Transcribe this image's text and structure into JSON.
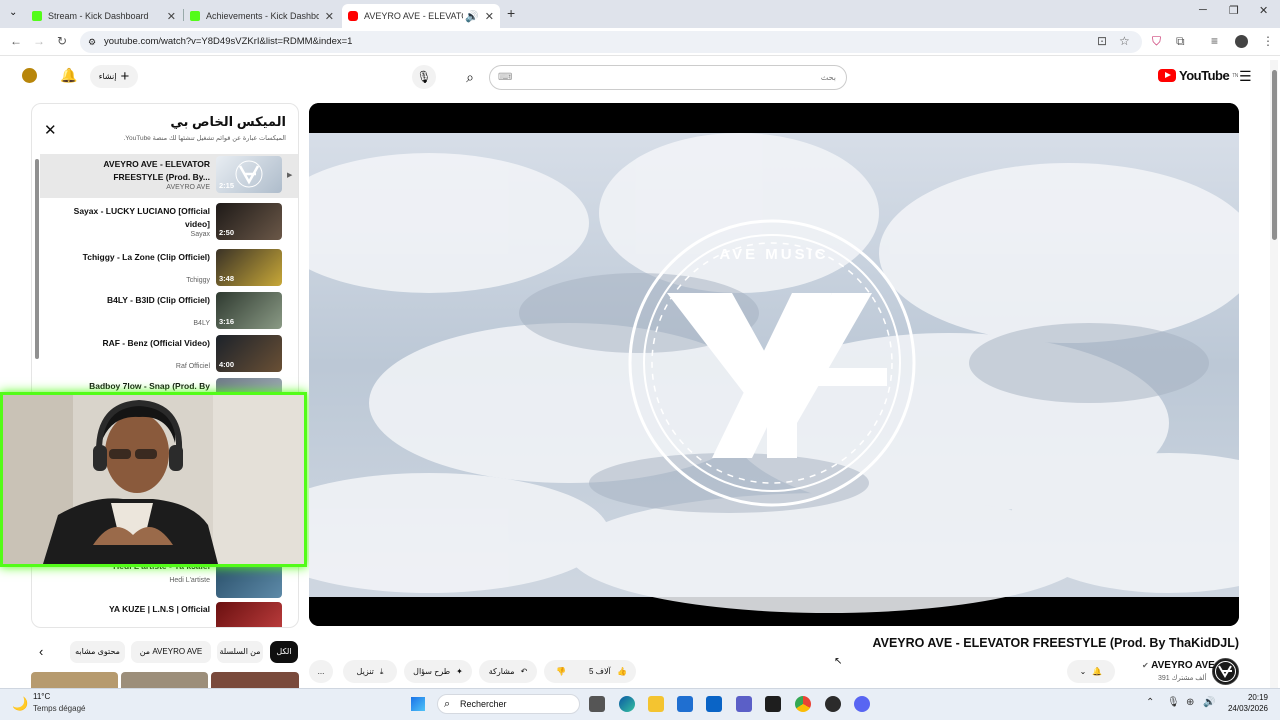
{
  "browser": {
    "tabs": [
      {
        "title": "Stream - Kick Dashboard",
        "favicon_color": "#53fc18"
      },
      {
        "title": "Achievements - Kick Dashboard",
        "favicon_color": "#53fc18"
      },
      {
        "title": "AVEYRO AVE - ELEVATOR FR",
        "favicon_color": "#ff0000",
        "active": true
      }
    ],
    "new_tab_label": "+",
    "url": "youtube.com/watch?v=Y8D49sVZKrI&list=RDMM&index=1"
  },
  "youtube": {
    "logo_text": "YouTube",
    "logo_region": "TN",
    "search_placeholder": "بحث",
    "create_label": "إنشاء",
    "playlist": {
      "title": "الميكس الخاص بي",
      "subtitle": "الميكسات عبارة عن قوائم تشغيل تنشئها لك منصة YouTube.",
      "items": [
        {
          "title": "AVEYRO AVE - ELEVATOR FREESTYLE (Prod. By...",
          "channel": "AVEYRO AVE",
          "duration": "2:15",
          "current": true,
          "thumb": "#c9d3de"
        },
        {
          "title": "Sayax - LUCKY LUCIANO [Official video]",
          "channel": "Sayax",
          "duration": "2:50",
          "current": false,
          "thumb": "#3c3530"
        },
        {
          "title": "Tchiggy - La Zone (Clip Officiel)",
          "channel": "Tchiggy",
          "duration": "3:48",
          "current": false,
          "thumb": "#5a4f3a"
        },
        {
          "title": "B4LY - B3ID (Clip Officiel)",
          "channel": "B4LY",
          "duration": "3:16",
          "current": false,
          "thumb": "#4b5a50"
        },
        {
          "title": "RAF - Benz (Official Video)",
          "channel": "Raf Officiel",
          "duration": "4:00",
          "current": false,
          "thumb": "#2e3540"
        },
        {
          "title": "Badboy 7low - Snap (Prod. By",
          "channel": "",
          "duration": "",
          "current": false,
          "thumb": "#6f7a88"
        }
      ],
      "partial_items": [
        {
          "title": "Hedi L'artiste - Ya k3alel",
          "channel": "Hedi L'artiste",
          "thumb": "#3d6b8a"
        },
        {
          "title": "YA KUZE | L.N.S | Official",
          "channel": "",
          "thumb": "#8a1c1c"
        }
      ]
    },
    "chips": [
      {
        "label": "الكل",
        "active": true
      },
      {
        "label": "من السلسلة",
        "active": false
      },
      {
        "label": "من AVEYRO AVE",
        "active": false
      },
      {
        "label": "محتوى مشابه",
        "active": false
      }
    ],
    "video": {
      "title": "AVEYRO AVE - ELEVATOR FREESTYLE (Prod. By ThaKidDJL)",
      "logo_text": "AVE MUSIC",
      "channel": "AVEYRO AVE",
      "subscribers": "391 ألف مشترك",
      "likes": "5 آلاف",
      "share_label": "مشاركة",
      "ask_label": "طرح سؤال",
      "download_label": "تنزيل",
      "more_label": "..."
    }
  },
  "taskbar": {
    "temperature": "11°C",
    "weather": "Temps dégagé",
    "search_label": "Rechercher",
    "time": "20:19",
    "date": "24/03/2026"
  }
}
